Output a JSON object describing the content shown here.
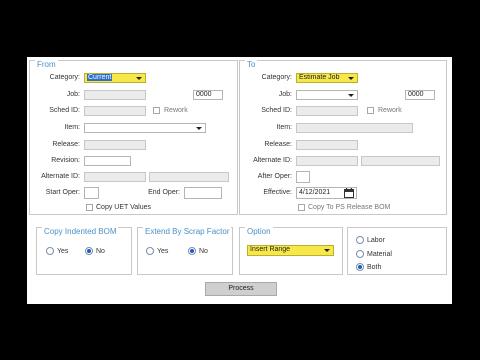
{
  "from": {
    "legend": "From",
    "category_label": "Category:",
    "category_value": "Current",
    "job_label": "Job:",
    "job_value": "",
    "job_number": "0000",
    "sched_label": "Sched ID:",
    "rework_label": "Rework",
    "item_label": "Item:",
    "release_label": "Release:",
    "revision_label": "Revision:",
    "alternate_label": "Alternate ID:",
    "start_oper_label": "Start Oper:",
    "end_oper_label": "End Oper:",
    "copy_uet_label": "Copy UET Values"
  },
  "to": {
    "legend": "To",
    "category_label": "Category:",
    "category_value": "Estimate Job",
    "job_label": "Job:",
    "job_value": "",
    "job_number": "0000",
    "sched_label": "Sched ID:",
    "rework_label": "Rework",
    "item_label": "Item:",
    "release_label": "Release:",
    "alternate_label": "Alternate ID:",
    "after_oper_label": "After Oper:",
    "effective_label": "Effective:",
    "effective_value": "4/12/2021",
    "copy_ps_label": "Copy To PS Release BOM",
    "calendar_icon": "calendar-icon"
  },
  "copy_indented_bom": {
    "legend": "Copy Indented BOM",
    "yes_label": "Yes",
    "no_label": "No",
    "selected": "No"
  },
  "extend_by_scrap": {
    "legend": "Extend By Scrap Factor",
    "yes_label": "Yes",
    "no_label": "No",
    "selected": "No"
  },
  "option": {
    "legend": "Option",
    "value": "Insert Range"
  },
  "type_group": {
    "labor_label": "Labor",
    "material_label": "Material",
    "both_label": "Both",
    "selected": "Both"
  },
  "process_label": "Process",
  "colors": {
    "legend_blue": "#4a90c8",
    "selection_yellow": "#f7e84a",
    "radio_blue": "#1b5eb8"
  }
}
